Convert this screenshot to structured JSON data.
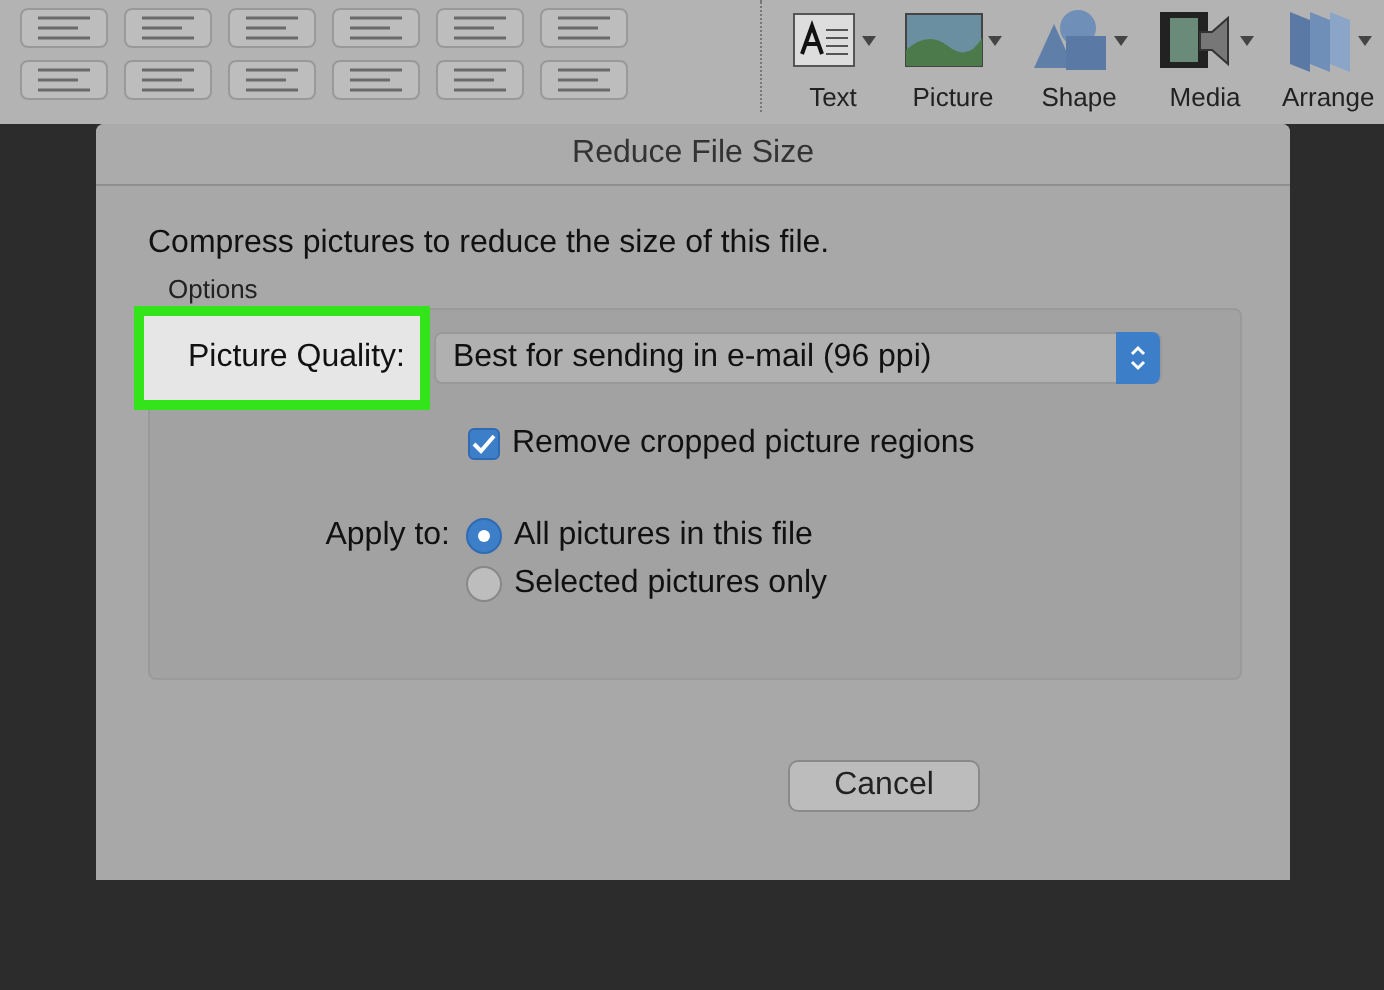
{
  "ribbon": {
    "buttons": [
      {
        "label": "Text",
        "kind": "text"
      },
      {
        "label": "Picture",
        "kind": "picture"
      },
      {
        "label": "Shape",
        "kind": "shape"
      },
      {
        "label": "Media",
        "kind": "media"
      },
      {
        "label": "Arrange",
        "kind": "arrange"
      }
    ]
  },
  "dialog": {
    "title": "Reduce File Size",
    "intro": "Compress pictures to reduce the size of this file.",
    "group_label": "Options",
    "quality_label": "Picture Quality:",
    "quality_value": "Best for sending in e-mail (96 ppi)",
    "remove_cropped": {
      "label": "Remove cropped picture regions",
      "checked": true
    },
    "apply_label": "Apply to:",
    "apply_options": [
      {
        "label": "All pictures in this file",
        "selected": true
      },
      {
        "label": "Selected pictures only",
        "selected": false
      }
    ],
    "buttons": [
      "Cancel"
    ]
  }
}
